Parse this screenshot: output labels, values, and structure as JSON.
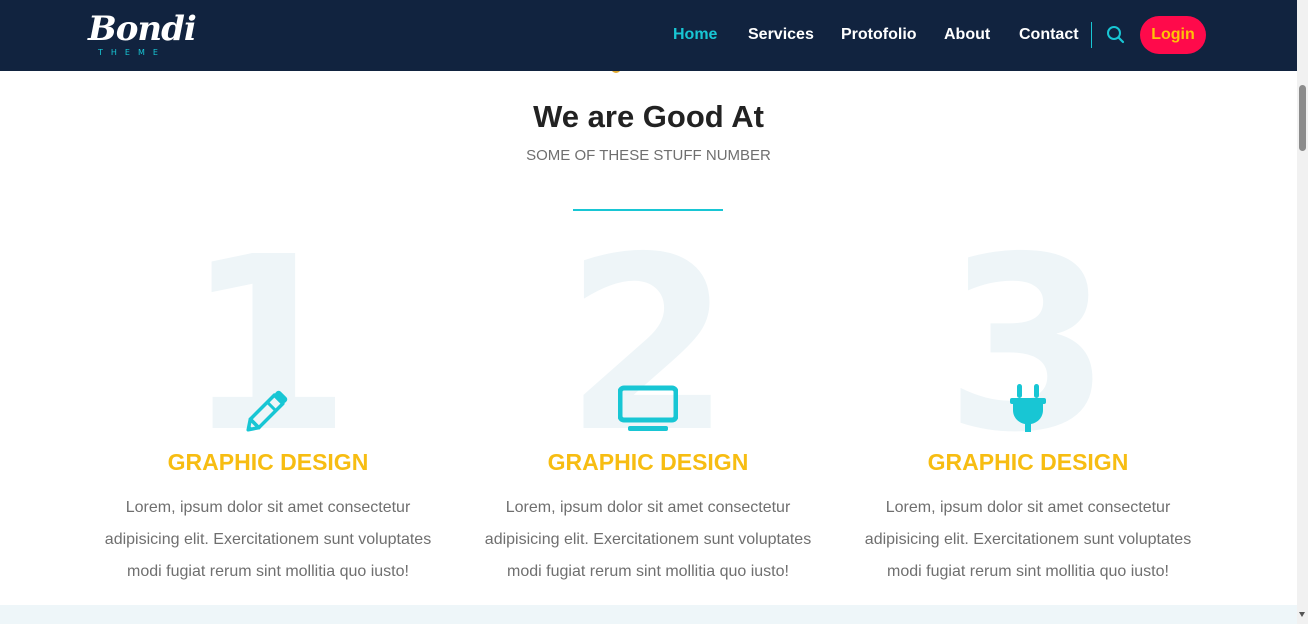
{
  "header": {
    "logo_script": "Bondi",
    "logo_sub": "THEME",
    "nav": [
      {
        "label": "Home",
        "active": true
      },
      {
        "label": "Services",
        "active": false
      },
      {
        "label": "Protofolio",
        "active": false
      },
      {
        "label": "About",
        "active": false
      },
      {
        "label": "Contact",
        "active": false
      }
    ],
    "search_icon": "search-icon",
    "login_label": "Login"
  },
  "section": {
    "title": "We are Good At",
    "subtitle": "SOME OF THESE STUFF NUMBER"
  },
  "cards": [
    {
      "number": "1",
      "icon": "pencil-icon",
      "title": "GRAPHIC DESIGN",
      "text": "Lorem, ipsum dolor sit amet consectetur adipisicing elit. Exercitationem sunt voluptates modi fugiat rerum sint mollitia quo iusto!"
    },
    {
      "number": "2",
      "icon": "monitor-icon",
      "title": "GRAPHIC DESIGN",
      "text": "Lorem, ipsum dolor sit amet consectetur adipisicing elit. Exercitationem sunt voluptates modi fugiat rerum sint mollitia quo iusto!"
    },
    {
      "number": "3",
      "icon": "plug-icon",
      "title": "GRAPHIC DESIGN",
      "text": "Lorem, ipsum dolor sit amet consectetur adipisicing elit. Exercitationem sunt voluptates modi fugiat rerum sint mollitia quo iusto!"
    }
  ],
  "colors": {
    "navbar": "#11233f",
    "accent": "#18c6d4",
    "title_yellow": "#f7bd12",
    "login_bg": "#ff0a4b",
    "login_text": "#ffc107"
  }
}
